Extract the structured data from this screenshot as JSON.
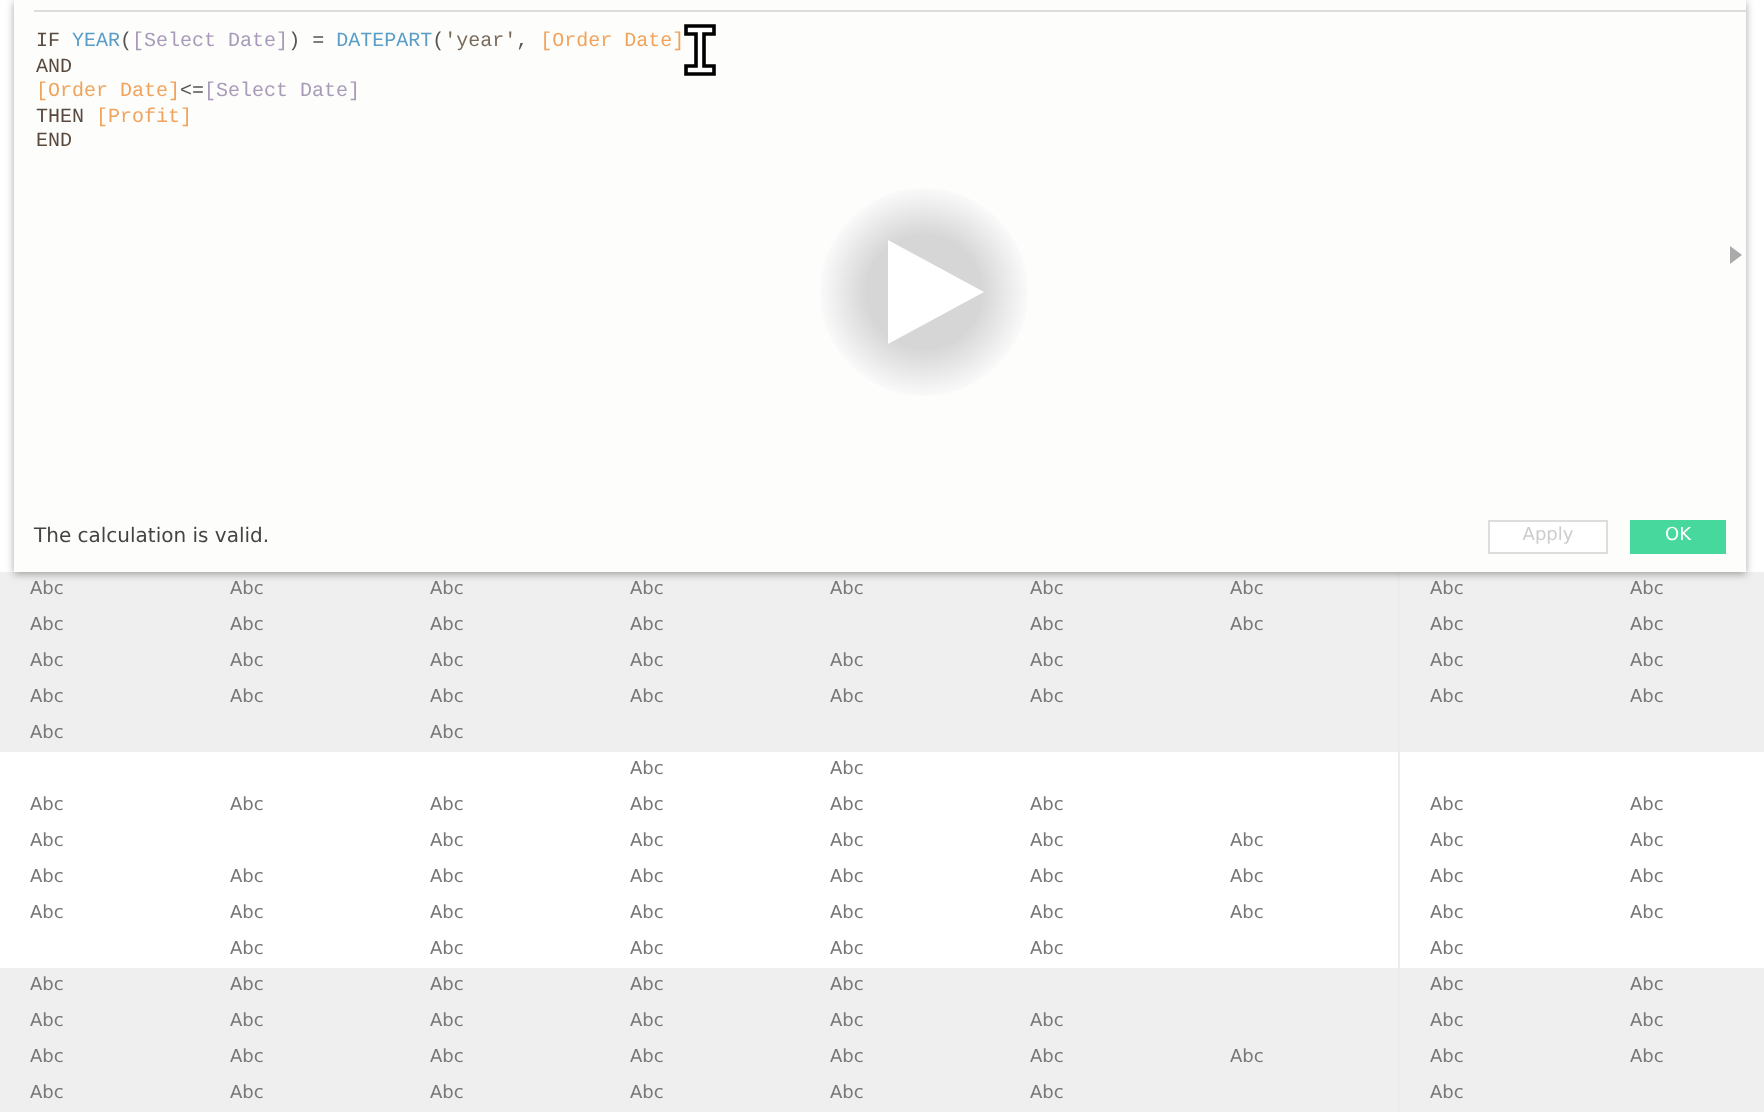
{
  "editor": {
    "code_lines": [
      [
        {
          "text": "IF ",
          "kind": "keyword"
        },
        {
          "text": "YEAR",
          "kind": "function"
        },
        {
          "text": "(",
          "kind": "operator"
        },
        {
          "text": "[Select Date]",
          "kind": "parameter"
        },
        {
          "text": ") = ",
          "kind": "operator"
        },
        {
          "text": "DATEPART",
          "kind": "function"
        },
        {
          "text": "(",
          "kind": "operator"
        },
        {
          "text": "'year'",
          "kind": "string"
        },
        {
          "text": ", ",
          "kind": "operator"
        },
        {
          "text": "[Order Date]",
          "kind": "field"
        }
      ],
      [
        {
          "text": "AND",
          "kind": "keyword"
        }
      ],
      [
        {
          "text": "[Order Date]",
          "kind": "field"
        },
        {
          "text": "<=",
          "kind": "operator"
        },
        {
          "text": "[Select Date]",
          "kind": "parameter"
        }
      ],
      [
        {
          "text": "THEN ",
          "kind": "keyword"
        },
        {
          "text": "[Profit]",
          "kind": "field"
        }
      ],
      [
        {
          "text": "END",
          "kind": "keyword"
        }
      ]
    ],
    "status": "The calculation is valid.",
    "buttons": [
      {
        "label": "Apply",
        "kind": "secondary",
        "disabled": true
      },
      {
        "label": "OK",
        "kind": "primary",
        "disabled": false
      }
    ]
  },
  "table": {
    "row_bands": [
      {
        "shaded": true,
        "rows": [
          [
            "Abc",
            "Abc",
            "Abc",
            "Abc",
            "Abc",
            "Abc",
            "Abc",
            "Abc",
            "Abc"
          ],
          [
            "Abc",
            "Abc",
            "Abc",
            "Abc",
            null,
            "Abc",
            "Abc",
            "Abc",
            "Abc"
          ],
          [
            "Abc",
            "Abc",
            "Abc",
            "Abc",
            "Abc",
            "Abc",
            null,
            "Abc",
            "Abc"
          ],
          [
            "Abc",
            "Abc",
            "Abc",
            "Abc",
            "Abc",
            "Abc",
            null,
            "Abc",
            "Abc"
          ],
          [
            "Abc",
            null,
            "Abc",
            null,
            null,
            null,
            null,
            null,
            null
          ]
        ]
      },
      {
        "shaded": false,
        "rows": [
          [
            null,
            null,
            null,
            "Abc",
            "Abc",
            null,
            null,
            null,
            null
          ],
          [
            "Abc",
            "Abc",
            "Abc",
            "Abc",
            "Abc",
            "Abc",
            null,
            "Abc",
            "Abc"
          ],
          [
            "Abc",
            null,
            "Abc",
            "Abc",
            "Abc",
            "Abc",
            "Abc",
            "Abc",
            "Abc"
          ],
          [
            "Abc",
            "Abc",
            "Abc",
            "Abc",
            "Abc",
            "Abc",
            "Abc",
            "Abc",
            "Abc"
          ],
          [
            "Abc",
            "Abc",
            "Abc",
            "Abc",
            "Abc",
            "Abc",
            "Abc",
            "Abc",
            "Abc"
          ],
          [
            null,
            "Abc",
            "Abc",
            "Abc",
            "Abc",
            "Abc",
            null,
            "Abc",
            null
          ]
        ]
      },
      {
        "shaded": true,
        "rows": [
          [
            "Abc",
            "Abc",
            "Abc",
            "Abc",
            "Abc",
            null,
            null,
            "Abc",
            "Abc"
          ],
          [
            "Abc",
            "Abc",
            "Abc",
            "Abc",
            "Abc",
            "Abc",
            null,
            "Abc",
            "Abc"
          ],
          [
            "Abc",
            "Abc",
            "Abc",
            "Abc",
            "Abc",
            "Abc",
            "Abc",
            "Abc",
            "Abc"
          ],
          [
            "Abc",
            "Abc",
            "Abc",
            "Abc",
            "Abc",
            "Abc",
            null,
            "Abc",
            null
          ]
        ]
      }
    ]
  }
}
